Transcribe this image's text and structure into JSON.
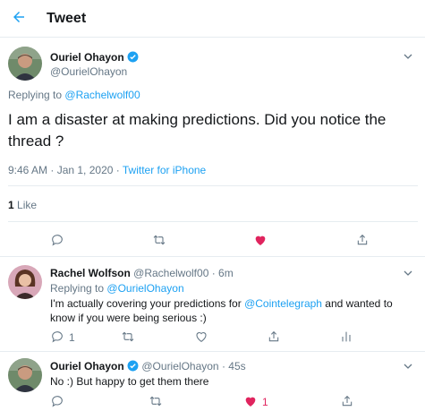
{
  "header": {
    "title": "Tweet"
  },
  "main_tweet": {
    "author_name": "Ouriel Ohayon",
    "author_handle": "@OurielOhayon",
    "replying_prefix": "Replying to",
    "replying_handle": "@Rachelwolf00",
    "text": "I am a disaster at making predictions. Did you notice the thread ?",
    "time": "9:46 AM · Jan 1, 2020 · ",
    "source": "Twitter for iPhone",
    "likes_count": "1",
    "likes_label": " Like"
  },
  "reply1": {
    "author_name": "Rachel Wolfson",
    "author_handle": "@Rachelwolf00",
    "age": " · 6m",
    "replying_prefix": "Replying to",
    "replying_handle": "@OurielOhayon",
    "text_before": "I'm actually covering your predictions for ",
    "mention": "@Cointelegraph",
    "text_after": "  and wanted to know if you were being serious :)",
    "reply_count": "1"
  },
  "reply2": {
    "author_name": "Ouriel Ohayon",
    "author_handle": "@OurielOhayon",
    "age": " · 45s",
    "text": "No :) But happy to get them there",
    "like_count": "1"
  },
  "colors": {
    "accent": "#1da1f2",
    "like": "#e0245e",
    "muted": "#657786",
    "divider": "#e6ecf0"
  }
}
